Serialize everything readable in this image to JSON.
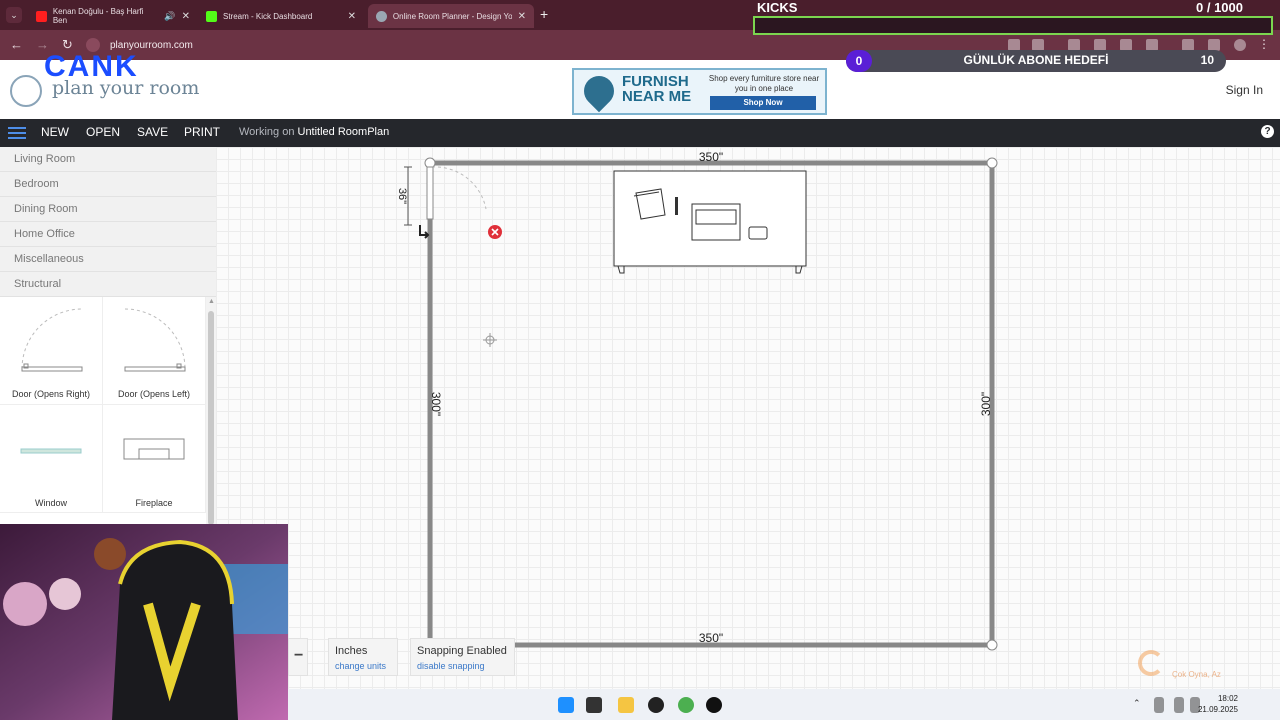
{
  "browser": {
    "tabs": [
      {
        "title": "Kenan Doğulu - Baş Harfi Ben",
        "active": false,
        "favicon_color": "#ff1f1f"
      },
      {
        "title": "Stream - Kick Dashboard",
        "active": false,
        "favicon_color": "#53fc18"
      },
      {
        "title": "Online Room Planner - Design Yo",
        "active": true,
        "favicon_color": "#9aa7b3"
      }
    ],
    "new_tab": "+",
    "url": "planyourroom.com"
  },
  "kicks_overlay": {
    "label": "KICKS",
    "count": "0 / 1000",
    "progress": 0
  },
  "goal_overlay": {
    "current": "0",
    "text": "GÜNLÜK ABONE HEDEFİ",
    "target": "10"
  },
  "site": {
    "logo_overlay": "CANK",
    "logo_text": "plan your room",
    "ad": {
      "title": "FURNISH NEAR ME",
      "copy": "Shop every furniture store near you in one place",
      "button": "Shop Now"
    },
    "signin": "Sign In"
  },
  "toolbar": {
    "new": "NEW",
    "open": "OPEN",
    "save": "SAVE",
    "print": "PRINT",
    "working_prefix": "Working on",
    "plan_name": "Untitled RoomPlan",
    "help": "?"
  },
  "sidebar": {
    "categories": [
      "Living Room",
      "Bedroom",
      "Dining Room",
      "Home Office",
      "Miscellaneous",
      "Structural"
    ],
    "items": [
      "Door (Opens Right)",
      "Door (Opens Left)",
      "Window",
      "Fireplace"
    ]
  },
  "plan": {
    "top_dim": "350\"",
    "bottom_dim": "350\"",
    "left_dim": "300\"",
    "right_dim": "300\"",
    "door_dim": "36\""
  },
  "controls": {
    "zoom_out": "−",
    "units": {
      "title": "Inches",
      "sub": "change units"
    },
    "snapping": {
      "title": "Snapping Enabled",
      "sub": "disable snapping"
    }
  },
  "watermark": {
    "text": "Çok Oyna, Az"
  },
  "taskbar": {
    "time": "18:02",
    "date": "21.09.2025"
  }
}
